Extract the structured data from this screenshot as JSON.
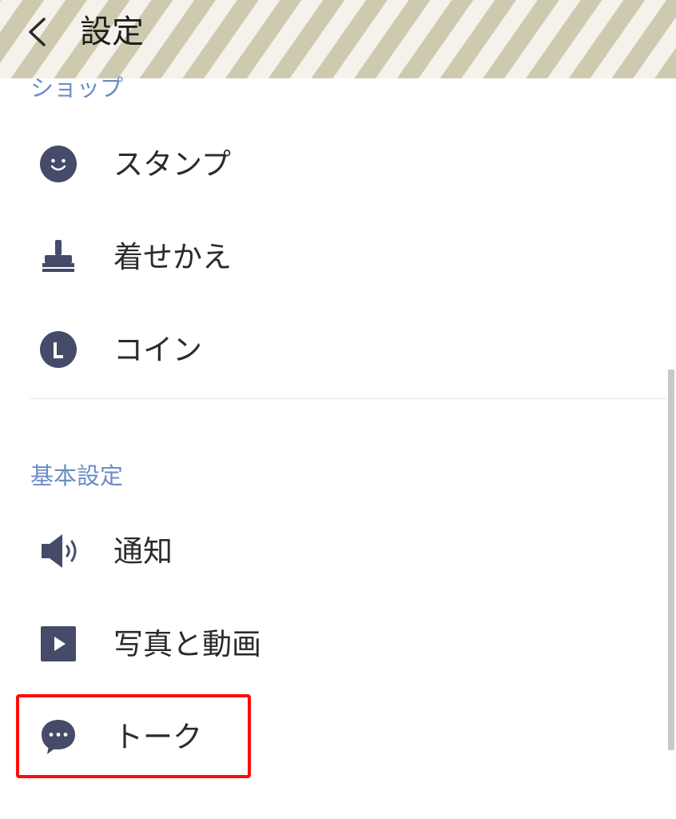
{
  "header": {
    "title": "設定",
    "back_icon": "chevron-left-icon"
  },
  "sections": [
    {
      "title": "ショップ",
      "items": [
        {
          "label": "スタンプ",
          "icon": "smiley-icon"
        },
        {
          "label": "着せかえ",
          "icon": "brush-icon"
        },
        {
          "label": "コイン",
          "icon": "coin-icon"
        }
      ]
    },
    {
      "title": "基本設定",
      "items": [
        {
          "label": "通知",
          "icon": "speaker-icon"
        },
        {
          "label": "写真と動画",
          "icon": "play-icon"
        },
        {
          "label": "トーク",
          "icon": "chat-bubble-icon"
        }
      ]
    }
  ],
  "colors": {
    "section_title": "#6b8ec4",
    "icon": "#454b68",
    "highlight": "#ff0a0a",
    "header_stripe": "#cdcab0"
  }
}
